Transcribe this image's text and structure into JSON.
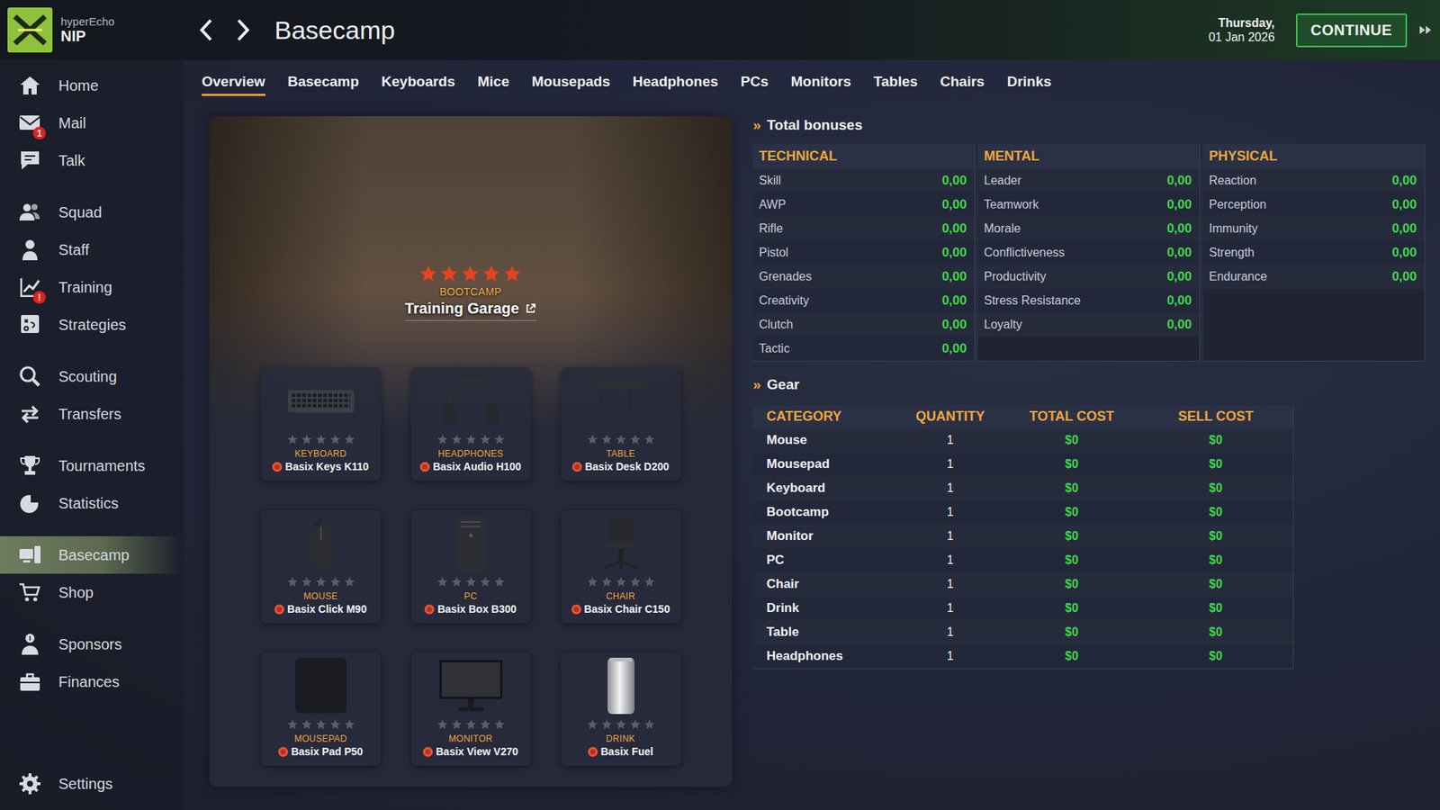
{
  "topbar": {
    "team_org": "hyperEcho",
    "team": "NIP",
    "title": "Basecamp",
    "day": "Thursday,",
    "date": "01 Jan 2026",
    "continue": "CONTINUE"
  },
  "sidebar": {
    "groups": [
      [
        {
          "label": "Home",
          "kind": "home",
          "badge": "",
          "selected": false
        },
        {
          "label": "Mail",
          "kind": "mail",
          "badge": "1",
          "selected": false
        },
        {
          "label": "Talk",
          "kind": "talk",
          "badge": "",
          "selected": false
        }
      ],
      [
        {
          "label": "Squad",
          "kind": "squad",
          "badge": "",
          "selected": false
        },
        {
          "label": "Staff",
          "kind": "staff",
          "badge": "",
          "selected": false
        },
        {
          "label": "Training",
          "kind": "training",
          "badge": "!",
          "selected": false
        },
        {
          "label": "Strategies",
          "kind": "strategies",
          "badge": "",
          "selected": false
        }
      ],
      [
        {
          "label": "Scouting",
          "kind": "scouting",
          "badge": "",
          "selected": false
        },
        {
          "label": "Transfers",
          "kind": "transfers",
          "badge": "",
          "selected": false
        }
      ],
      [
        {
          "label": "Tournaments",
          "kind": "tournaments",
          "badge": "",
          "selected": false
        },
        {
          "label": "Statistics",
          "kind": "statistics",
          "badge": "",
          "selected": false
        }
      ],
      [
        {
          "label": "Basecamp",
          "kind": "basecamp",
          "badge": "",
          "selected": true
        },
        {
          "label": "Shop",
          "kind": "shop",
          "badge": "",
          "selected": false
        }
      ],
      [
        {
          "label": "Sponsors",
          "kind": "sponsors",
          "badge": "",
          "selected": false
        },
        {
          "label": "Finances",
          "kind": "finances",
          "badge": "",
          "selected": false
        }
      ]
    ],
    "footer": {
      "label": "Settings",
      "kind": "settings",
      "badge": "",
      "selected": false
    }
  },
  "tabs": [
    {
      "label": "Overview",
      "selected": true
    },
    {
      "label": "Basecamp",
      "selected": false
    },
    {
      "label": "Keyboards",
      "selected": false
    },
    {
      "label": "Mice",
      "selected": false
    },
    {
      "label": "Mousepads",
      "selected": false
    },
    {
      "label": "Headphones",
      "selected": false
    },
    {
      "label": "PCs",
      "selected": false
    },
    {
      "label": "Monitors",
      "selected": false
    },
    {
      "label": "Tables",
      "selected": false
    },
    {
      "label": "Chairs",
      "selected": false
    },
    {
      "label": "Drinks",
      "selected": false
    }
  ],
  "bootcamp": {
    "category": "BOOTCAMP",
    "name": "Training Garage",
    "stars": 5
  },
  "gear_cards": [
    {
      "kind": "keyboard",
      "category": "KEYBOARD",
      "name": "Basix Keys K110",
      "stars": 0
    },
    {
      "kind": "headphones",
      "category": "HEADPHONES",
      "name": "Basix Audio H100",
      "stars": 0
    },
    {
      "kind": "table",
      "category": "TABLE",
      "name": "Basix Desk D200",
      "stars": 0
    },
    {
      "kind": "mouse",
      "category": "MOUSE",
      "name": "Basix Click M90",
      "stars": 0
    },
    {
      "kind": "pc",
      "category": "PC",
      "name": "Basix Box B300",
      "stars": 0
    },
    {
      "kind": "chair",
      "category": "CHAIR",
      "name": "Basix Chair C150",
      "stars": 0
    },
    {
      "kind": "mousepad",
      "category": "MOUSEPAD",
      "name": "Basix Pad P50",
      "stars": 0
    },
    {
      "kind": "monitor",
      "category": "MONITOR",
      "name": "Basix View V270",
      "stars": 0
    },
    {
      "kind": "drink",
      "category": "DRINK",
      "name": "Basix Fuel",
      "stars": 0
    }
  ],
  "bonuses": {
    "marker": "»",
    "title": "Total bonuses",
    "groups": [
      {
        "title": "TECHNICAL",
        "rows": [
          {
            "label": "Skill",
            "value": "0,00"
          },
          {
            "label": "AWP",
            "value": "0,00"
          },
          {
            "label": "Rifle",
            "value": "0,00"
          },
          {
            "label": "Pistol",
            "value": "0,00"
          },
          {
            "label": "Grenades",
            "value": "0,00"
          },
          {
            "label": "Creativity",
            "value": "0,00"
          },
          {
            "label": "Clutch",
            "value": "0,00"
          },
          {
            "label": "Tactic",
            "value": "0,00"
          }
        ]
      },
      {
        "title": "MENTAL",
        "rows": [
          {
            "label": "Leader",
            "value": "0,00"
          },
          {
            "label": "Teamwork",
            "value": "0,00"
          },
          {
            "label": "Morale",
            "value": "0,00"
          },
          {
            "label": "Conflictiveness",
            "value": "0,00"
          },
          {
            "label": "Productivity",
            "value": "0,00"
          },
          {
            "label": "Stress Resistance",
            "value": "0,00"
          },
          {
            "label": "Loyalty",
            "value": "0,00"
          }
        ]
      },
      {
        "title": "PHYSICAL",
        "rows": [
          {
            "label": "Reaction",
            "value": "0,00"
          },
          {
            "label": "Perception",
            "value": "0,00"
          },
          {
            "label": "Immunity",
            "value": "0,00"
          },
          {
            "label": "Strength",
            "value": "0,00"
          },
          {
            "label": "Endurance",
            "value": "0,00"
          }
        ]
      }
    ]
  },
  "gear": {
    "marker": "»",
    "title": "Gear",
    "columns": [
      "CATEGORY",
      "QUANTITY",
      "TOTAL COST",
      "SELL COST"
    ],
    "rows": [
      {
        "category": "Mouse",
        "quantity": "1",
        "total_cost": "$0",
        "sell_cost": "$0"
      },
      {
        "category": "Mousepad",
        "quantity": "1",
        "total_cost": "$0",
        "sell_cost": "$0"
      },
      {
        "category": "Keyboard",
        "quantity": "1",
        "total_cost": "$0",
        "sell_cost": "$0"
      },
      {
        "category": "Bootcamp",
        "quantity": "1",
        "total_cost": "$0",
        "sell_cost": "$0"
      },
      {
        "category": "Monitor",
        "quantity": "1",
        "total_cost": "$0",
        "sell_cost": "$0"
      },
      {
        "category": "PC",
        "quantity": "1",
        "total_cost": "$0",
        "sell_cost": "$0"
      },
      {
        "category": "Chair",
        "quantity": "1",
        "total_cost": "$0",
        "sell_cost": "$0"
      },
      {
        "category": "Drink",
        "quantity": "1",
        "total_cost": "$0",
        "sell_cost": "$0"
      },
      {
        "category": "Table",
        "quantity": "1",
        "total_cost": "$0",
        "sell_cost": "$0"
      },
      {
        "category": "Headphones",
        "quantity": "1",
        "total_cost": "$0",
        "sell_cost": "$0"
      }
    ]
  }
}
